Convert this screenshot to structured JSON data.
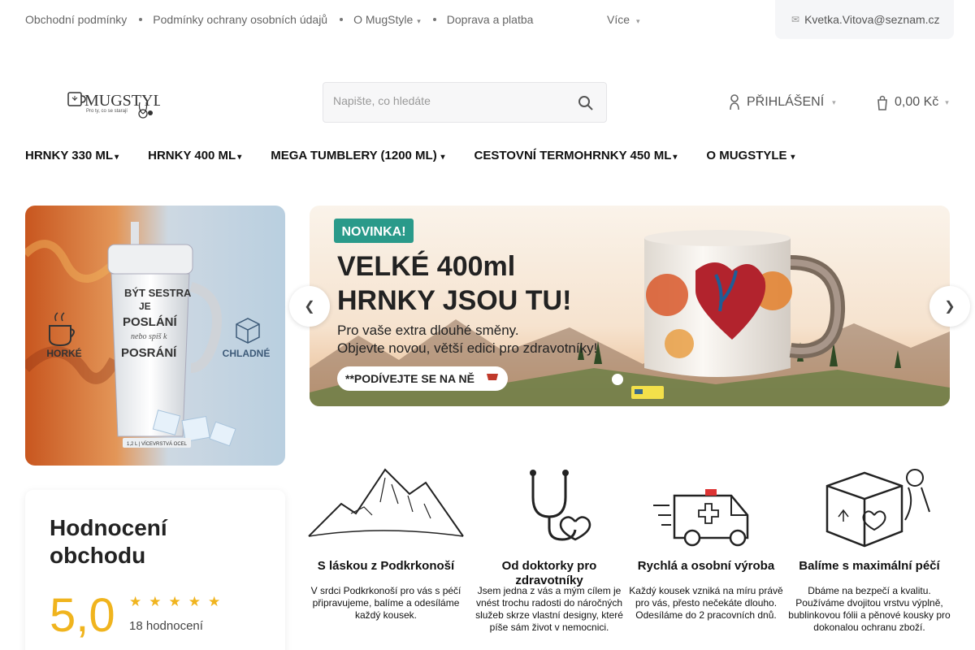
{
  "topbar": {
    "links": [
      {
        "label": "Obchodní podmínky"
      },
      {
        "label": "Podmínky ochrany osobních údajů"
      },
      {
        "label": "O MugStyle"
      },
      {
        "label": "Doprava a platba"
      }
    ],
    "more_label": "Více",
    "user_email": "Kvetka.Vitova@seznam.cz"
  },
  "header": {
    "logo_text": "MUGSTYLE",
    "logo_tagline": "Pro ty, co se starají",
    "search_placeholder": "Napište, co hledáte",
    "login_label": "PŘIHLÁŠENÍ",
    "cart_total": "0,00 Kč"
  },
  "nav": {
    "items": [
      {
        "label": "HRNKY 330 ML"
      },
      {
        "label": "HRNKY 400 ML"
      },
      {
        "label": "MEGA TUMBLERY (1200 ML)"
      },
      {
        "label": "CESTOVNÍ TERMOHRNKY 450 ML"
      },
      {
        "label": "O MUGSTYLE"
      }
    ]
  },
  "promo": {
    "hot_label": "HORKÉ",
    "cold_label": "CHLADNÉ",
    "tumbler_text": "BÝT SESTRA JE POSLÁNÍ nebo spíš k POSRÁNÍ",
    "badge": "1,2 L | VÍCEVRSTVÁ OCEL"
  },
  "hero": {
    "badge": "NOVINKA!",
    "headline_1": "VELKÉ 400ml",
    "headline_2": "HRNKY JSOU TU!",
    "sub_1": "Pro vaše extra dlouhé směny.",
    "sub_2": "Objevte novou, větší edici pro zdravotníky!",
    "cta": "**PODÍVEJTE SE NA NĚ"
  },
  "rating": {
    "title": "Hodnocení obchodu",
    "score": "5,0",
    "stars": 5,
    "count": "18 hodnocení"
  },
  "features": [
    {
      "title": "S láskou z Podkrkonoší",
      "desc": "V srdci Podkrkonoší pro vás s péčí připravujeme, balíme a odesíláme každý kousek."
    },
    {
      "title": "Od doktorky pro zdravotníky",
      "desc": "Jsem jedna z vás a mým cílem je vnést trochu radosti do náročných služeb skrze vlastní designy, které píše sám život v nemocnici."
    },
    {
      "title": "Rychlá a osobní výroba",
      "desc": "Každý kousek vzniká na míru právě pro vás, přesto nečekáte dlouho. Odesíláme do 2 pracovních dnů."
    },
    {
      "title": "Balíme s maximální péčí",
      "desc": "Dbáme na bezpečí a kvalitu. Používáme dvojitou vrstvu výplně, bublinkovou fólii a pěnové kousky pro dokonalou ochranu zboží."
    }
  ]
}
